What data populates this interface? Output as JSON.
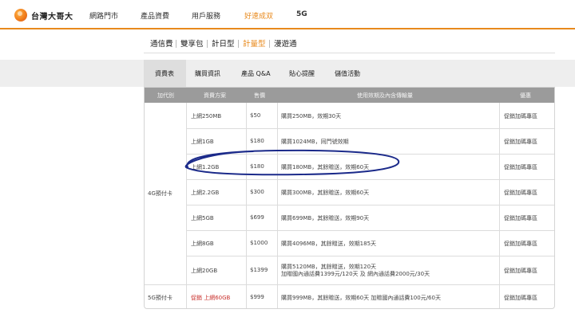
{
  "brand": {
    "name": "台灣大哥大"
  },
  "topnav": {
    "items": [
      {
        "label": "網路門市"
      },
      {
        "label": "產品資費"
      },
      {
        "label": "用戶服務"
      },
      {
        "label": "好速成双"
      },
      {
        "label": "5G"
      }
    ],
    "accent_color": "#e8891c"
  },
  "subtabs": {
    "items": [
      {
        "label": "通信費"
      },
      {
        "label": "雙享包"
      },
      {
        "label": "計日型"
      },
      {
        "label": "計量型",
        "active": true
      },
      {
        "label": "漫遊通"
      }
    ]
  },
  "menu": {
    "items": [
      {
        "label": "資費表",
        "active": true
      },
      {
        "label": "購買資訊"
      },
      {
        "label": "產品 Q&A"
      },
      {
        "label": "貼心提醒"
      },
      {
        "label": "儲值活動"
      }
    ]
  },
  "table": {
    "headers": [
      "加代別",
      "資費方案",
      "售價",
      "使用效期及內含傳輸量",
      "優惠"
    ],
    "groups": [
      {
        "label": "4G預付卡"
      },
      {
        "label": "5G預付卡"
      }
    ],
    "rows": [
      {
        "plan": "上網250MB",
        "price": "$50",
        "desc1": "購買250MB，效期30天",
        "desc2": "",
        "offer": "促銷加碼專區"
      },
      {
        "plan": "上網1GB",
        "price": "$180",
        "desc1": "購買1024MB，同門號效期",
        "desc2": "",
        "offer": "促銷加碼專區"
      },
      {
        "plan": "上網1.2GB",
        "price": "$180",
        "desc1": "購買180MB，其餘贈送，效期60天",
        "desc2": "",
        "offer": "促銷加碼專區"
      },
      {
        "plan": "上網2.2GB",
        "price": "$300",
        "desc1": "購買300MB，其餘贈送，效期60天",
        "desc2": "",
        "offer": "促銷加碼專區"
      },
      {
        "plan": "上網5GB",
        "price": "$699",
        "desc1": "購買699MB，其餘贈送，效期90天",
        "desc2": "",
        "offer": "促銷加碼專區"
      },
      {
        "plan": "上網8GB",
        "price": "$1000",
        "desc1": "購買4096MB，其餘贈送，效期185天",
        "desc2": "",
        "offer": "促銷加碼專區"
      },
      {
        "plan": "上網20GB",
        "price": "$1399",
        "desc1": "購買5120MB，其餘贈送，效期120天",
        "desc2": "加贈國內通話費1399元/120天 及 網內通話費2000元/30天",
        "offer": "促銷加碼專區"
      },
      {
        "plan": "促銷 上網60GB",
        "price": "$999",
        "desc1": "購買999MB，其餘贈送，效期60天 加贈國內通話費100元/60天",
        "desc2": "",
        "offer": "促銷加碼專區",
        "promo": true
      }
    ],
    "promo_color": "#c9302c",
    "header_bg": "#9b9b9b"
  }
}
